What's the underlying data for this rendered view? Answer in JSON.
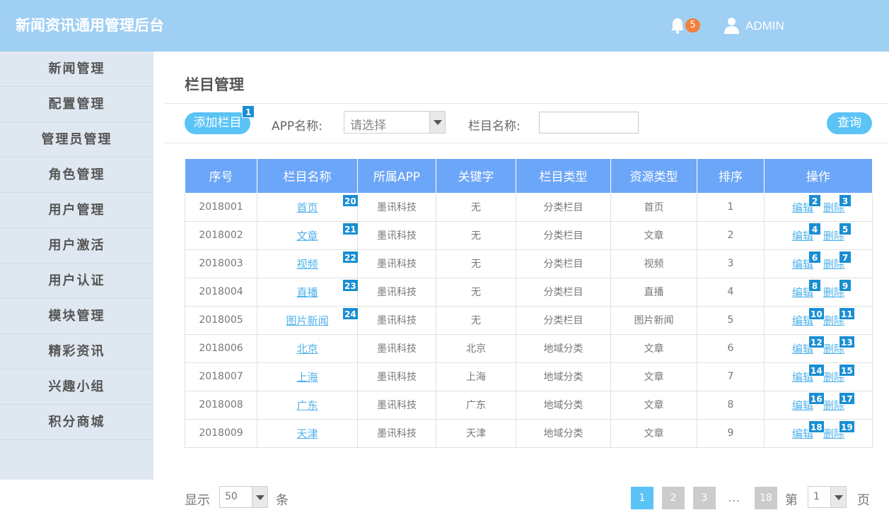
{
  "header": {
    "title": "新闻资讯通用管理后台",
    "notification_count": "5",
    "user": "ADMIN"
  },
  "sidebar": {
    "items": [
      "新闻管理",
      "配置管理",
      "管理员管理",
      "角色管理",
      "用户管理",
      "用户激活",
      "用户认证",
      "模块管理",
      "精彩资讯",
      "兴趣小组",
      "积分商城"
    ]
  },
  "main": {
    "page_title": "栏目管理",
    "toolbar": {
      "add_label": "添加栏目",
      "add_tag": "1",
      "app_label": "APP名称:",
      "app_placeholder": "请选择",
      "name_label": "栏目名称:",
      "name_value": "",
      "query_label": "查询"
    },
    "table": {
      "headers": [
        "序号",
        "栏目名称",
        "所属APP",
        "关键字",
        "栏目类型",
        "资源类型",
        "排序",
        "操作"
      ],
      "edit_label": "编辑",
      "delete_label": "删除",
      "rows": [
        {
          "id": "2018001",
          "name": "首页",
          "name_tag": "20",
          "app": "墨讯科技",
          "keyword": "无",
          "type": "分类栏目",
          "resource": "首页",
          "order": "1",
          "edit_tag": "2",
          "del_tag": "3"
        },
        {
          "id": "2018002",
          "name": "文章",
          "name_tag": "21",
          "app": "墨讯科技",
          "keyword": "无",
          "type": "分类栏目",
          "resource": "文章",
          "order": "2",
          "edit_tag": "4",
          "del_tag": "5"
        },
        {
          "id": "2018003",
          "name": "视频",
          "name_tag": "22",
          "app": "墨讯科技",
          "keyword": "无",
          "type": "分类栏目",
          "resource": "视频",
          "order": "3",
          "edit_tag": "6",
          "del_tag": "7"
        },
        {
          "id": "2018004",
          "name": "直播",
          "name_tag": "23",
          "app": "墨讯科技",
          "keyword": "无",
          "type": "分类栏目",
          "resource": "直播",
          "order": "4",
          "edit_tag": "8",
          "del_tag": "9"
        },
        {
          "id": "2018005",
          "name": "图片新闻",
          "name_tag": "24",
          "app": "墨讯科技",
          "keyword": "无",
          "type": "分类栏目",
          "resource": "图片新闻",
          "order": "5",
          "edit_tag": "10",
          "del_tag": "11"
        },
        {
          "id": "2018006",
          "name": "北京",
          "name_tag": "",
          "app": "墨讯科技",
          "keyword": "北京",
          "type": "地域分类",
          "resource": "文章",
          "order": "6",
          "edit_tag": "12",
          "del_tag": "13"
        },
        {
          "id": "2018007",
          "name": "上海",
          "name_tag": "",
          "app": "墨讯科技",
          "keyword": "上海",
          "type": "地域分类",
          "resource": "文章",
          "order": "7",
          "edit_tag": "14",
          "del_tag": "15"
        },
        {
          "id": "2018008",
          "name": "广东",
          "name_tag": "",
          "app": "墨讯科技",
          "keyword": "广东",
          "type": "地域分类",
          "resource": "文章",
          "order": "8",
          "edit_tag": "16",
          "del_tag": "17"
        },
        {
          "id": "2018009",
          "name": "天津",
          "name_tag": "",
          "app": "墨讯科技",
          "keyword": "天津",
          "type": "地域分类",
          "resource": "文章",
          "order": "9",
          "edit_tag": "18",
          "del_tag": "19"
        }
      ]
    },
    "pagination": {
      "show_label": "显示",
      "page_size": "50",
      "unit_label": "条",
      "pages": [
        "1",
        "2",
        "3"
      ],
      "ellipsis": "...",
      "last_page": "18",
      "goto_prefix": "第",
      "goto_value": "1",
      "goto_suffix": "页"
    }
  },
  "colors": {
    "header_bg": "#9fcff3",
    "sidebar_bg": "#dfe8f1",
    "table_header": "#6ca6f8",
    "accent": "#5bc3f6",
    "tag": "#1a8ed3",
    "badge": "#f2813b"
  }
}
